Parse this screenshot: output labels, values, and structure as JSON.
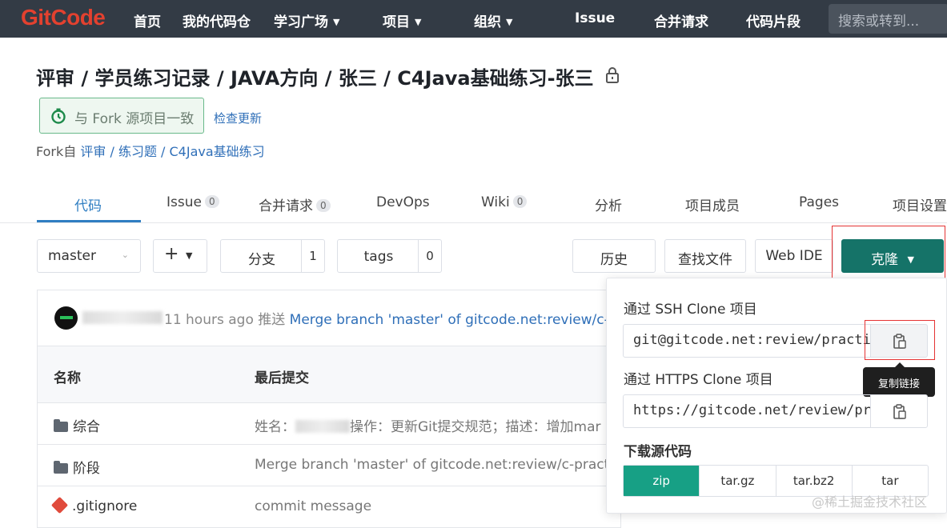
{
  "nav": {
    "logo": "GitCode",
    "items": [
      {
        "label": "首页",
        "dropdown": false
      },
      {
        "label": "我的代码仓",
        "dropdown": false
      },
      {
        "label": "学习广场",
        "dropdown": true
      },
      {
        "label": "项目",
        "dropdown": true
      },
      {
        "label": "组织",
        "dropdown": true
      },
      {
        "label": "Issue",
        "dropdown": false
      },
      {
        "label": "合并请求",
        "dropdown": false
      },
      {
        "label": "代码片段",
        "dropdown": false
      }
    ],
    "search_placeholder": "搜索或转到..."
  },
  "project": {
    "title": "评审 / 学员练习记录 / JAVA方向 / 张三 / C4Java基础练习-张三",
    "fork_status": "与 Fork 源项目一致",
    "check_update": "检查更新",
    "forked_from_prefix": "Fork自",
    "forked_from_path": "评审 / 练习题 / C4Java基础练习"
  },
  "tabs": [
    {
      "label": "代码",
      "count": null,
      "active": true
    },
    {
      "label": "Issue",
      "count": "0"
    },
    {
      "label": "合并请求",
      "count": "0"
    },
    {
      "label": "DevOps",
      "count": null
    },
    {
      "label": "Wiki",
      "count": "0"
    },
    {
      "label": "分析",
      "count": null
    },
    {
      "label": "项目成员",
      "count": null
    },
    {
      "label": "Pages",
      "count": null
    },
    {
      "label": "项目设置",
      "count": null
    }
  ],
  "toolbar": {
    "branch": "master",
    "plus": "+",
    "branches_label": "分支",
    "branches_count": "1",
    "tags_label": "tags",
    "tags_count": "0",
    "history": "历史",
    "find_file": "查找文件",
    "web_ide": "Web IDE",
    "clone": "克隆"
  },
  "last_commit": {
    "author_fragment": "han",
    "time": "11 hours ago",
    "action": "推送",
    "message": "Merge branch 'master' of gitcode.net:review/c-prac"
  },
  "file_table": {
    "headers": {
      "name": "名称",
      "last_commit": "最后提交"
    },
    "rows": [
      {
        "type": "folder",
        "name": "综合",
        "msg_prefix": "姓名：",
        "msg_suffix": "操作：更新Git提交规范；描述：增加mar"
      },
      {
        "type": "folder",
        "name": "阶段",
        "msg_prefix": "Merge branch 'master' of gitcode.net:review/c-practice/c",
        "msg_suffix": ""
      },
      {
        "type": "git",
        "name": ".gitignore",
        "msg_prefix": "commit message",
        "msg_suffix": ""
      }
    ]
  },
  "clone_dropdown": {
    "ssh_label": "通过 SSH Clone 项目",
    "ssh_url": "git@gitcode.net:review/practice",
    "copy_tooltip": "复制链接",
    "https_label": "通过 HTTPS Clone 项目",
    "https_url": "https://gitcode.net/review/practice",
    "download_label": "下载源代码",
    "download_options": [
      "zip",
      "tar.gz",
      "tar.bz2",
      "tar"
    ],
    "active_download": "zip"
  },
  "watermark": "@稀土掘金技术社区",
  "colors": {
    "nav_bg": "#333b45",
    "brand": "#e3412f",
    "clone_btn": "#157368",
    "zip_active": "#17a085",
    "link": "#2f6fb8",
    "highlight_box": "#e53333"
  }
}
